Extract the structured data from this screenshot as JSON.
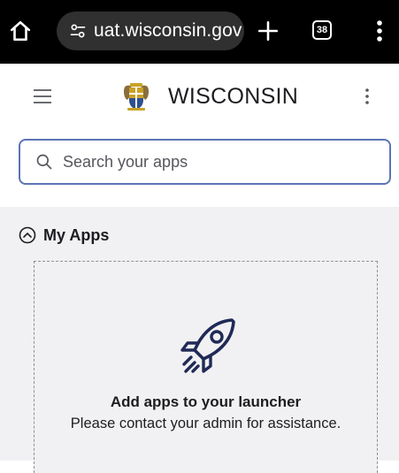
{
  "browser": {
    "url": "uat.wisconsin.gov",
    "tab_count": "38"
  },
  "header": {
    "brand": "WISCONSIN"
  },
  "search": {
    "placeholder": "Search your apps",
    "value": ""
  },
  "my_apps": {
    "title": "My Apps",
    "empty_title": "Add apps to your launcher",
    "empty_message": "Please contact your admin for assistance."
  },
  "icons": {
    "home": "home-icon",
    "site_settings": "tune-icon",
    "new_tab": "plus-icon",
    "tabs": "tab-count-icon",
    "browser_menu": "more-vertical-icon",
    "nav_menu": "hamburger-icon",
    "seal": "state-seal-icon",
    "app_menu": "more-vertical-icon",
    "search": "search-icon",
    "collapse": "chevron-up-circle-icon",
    "empty_state": "rocket-icon"
  },
  "colors": {
    "browser_bar": "#000000",
    "url_pill": "#303030",
    "search_border": "#5b74b5",
    "apps_background": "#f1f1f3",
    "text": "#1d1d21",
    "seal_blue": "#2f4f8f",
    "seal_gold": "#c9a227"
  }
}
